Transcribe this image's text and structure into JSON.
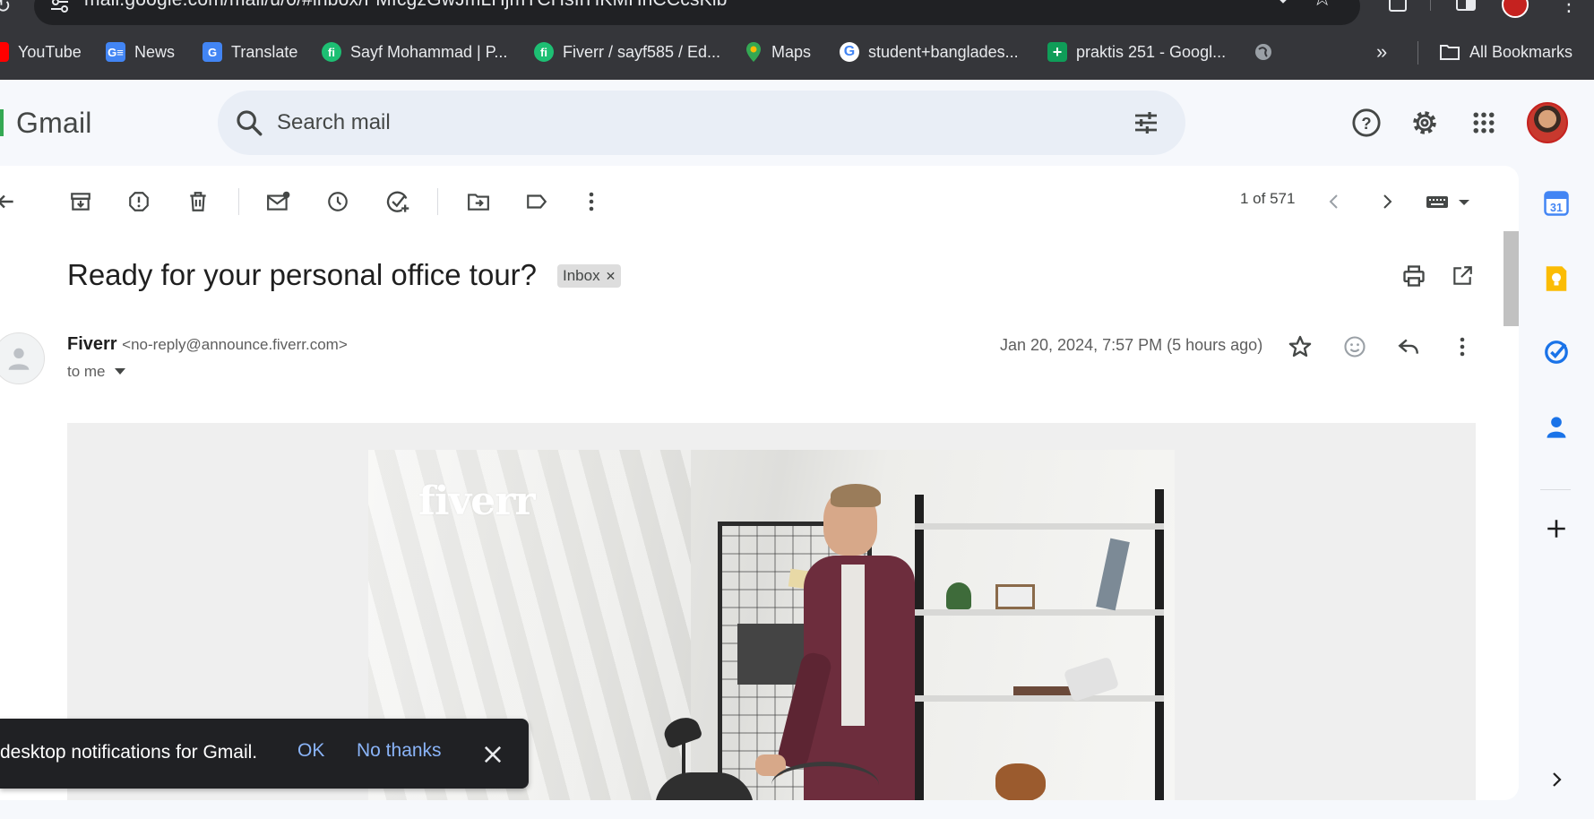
{
  "browser": {
    "url": "mail.google.com/mail/u/0/#inbox/FMfcgzGwJmLHjmTCHsIrHKMHhCCcsKlb",
    "bookmarks": [
      {
        "label": "YouTube",
        "icon": "youtube-icon",
        "color": "#ff0000"
      },
      {
        "label": "News",
        "icon": "google-news-icon",
        "color": "#4285f4"
      },
      {
        "label": "Translate",
        "icon": "google-translate-icon",
        "color": "#4285f4"
      },
      {
        "label": "Sayf Mohammad | P...",
        "icon": "fiverr-icon",
        "color": "#1dbf73"
      },
      {
        "label": "Fiverr / sayf585 / Ed...",
        "icon": "fiverr-icon",
        "color": "#1dbf73"
      },
      {
        "label": "Maps",
        "icon": "google-maps-icon",
        "color": "#34a853"
      },
      {
        "label": "student+banglades...",
        "icon": "google-icon",
        "color": "#4285f4"
      },
      {
        "label": "praktis 251 - Googl...",
        "icon": "google-sheets-icon",
        "color": "#0f9d58"
      }
    ],
    "all_bookmarks_label": "All Bookmarks"
  },
  "gmail": {
    "logo_text": "Gmail",
    "search_placeholder": "Search mail"
  },
  "toolbar": {
    "pager": "1 of 571"
  },
  "message": {
    "subject": "Ready for your personal office tour?",
    "label_chip": "Inbox",
    "sender_name": "Fiverr",
    "sender_email": "<no-reply@announce.fiverr.com>",
    "recipient": "to me",
    "date": "Jan 20, 2024, 7:57 PM (5 hours ago)",
    "hero_logo": "fiverr"
  },
  "toast": {
    "text": "desktop notifications for Gmail.",
    "ok_label": "OK",
    "no_label": "No thanks"
  },
  "colors": {
    "accent_blue": "#0b57d0",
    "gmail_bg": "#f6f8fc",
    "search_bg": "#e9eef6",
    "chrome_dark": "#35363a",
    "toast_link": "#8ab4f8"
  }
}
